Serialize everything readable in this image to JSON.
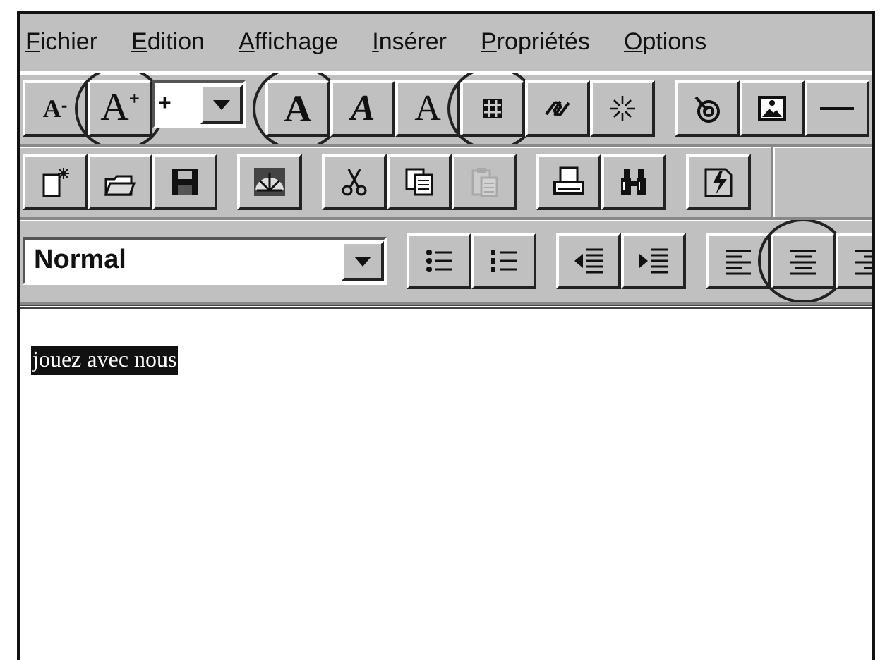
{
  "menu": [
    {
      "label": "Fichier"
    },
    {
      "label": "Edition"
    },
    {
      "label": "Affichage"
    },
    {
      "label": "Insérer"
    },
    {
      "label": "Propriétés"
    },
    {
      "label": "Options"
    }
  ],
  "toolbars": [
    {
      "groups": [
        [
          {
            "kind": "smaller",
            "label": "A$^{-}$",
            "circled": false
          },
          {
            "kind": "larger",
            "label": "A$^{+}$",
            "circled": true
          },
          {
            "kind": "size",
            "value": "+"
          }
        ],
        [
          {
            "kind": "bold",
            "label": "A",
            "circled": true
          },
          {
            "kind": "italic",
            "label": "A",
            "circled": false
          },
          {
            "kind": "fixed",
            "label": "A",
            "circled": false
          },
          {
            "kind": "table",
            "circled": true
          },
          {
            "kind": "link",
            "circled": false
          },
          {
            "kind": "sparkle",
            "circled": false
          }
        ],
        [
          {
            "kind": "target",
            "circled": false
          },
          {
            "kind": "image",
            "circled": false
          },
          {
            "kind": "rule",
            "circled": false
          }
        ]
      ]
    },
    {
      "groups": [
        [
          {
            "kind": "new",
            "circled": false,
            "disabled": false
          },
          {
            "kind": "open",
            "circled": false,
            "disabled": false
          },
          {
            "kind": "save",
            "circled": false,
            "disabled": false
          }
        ],
        [
          {
            "kind": "navigator",
            "circled": false,
            "disabled": false
          }
        ],
        [
          {
            "kind": "cut",
            "circled": false,
            "disabled": false
          },
          {
            "kind": "copy",
            "circled": false,
            "disabled": false
          },
          {
            "kind": "paste",
            "circled": false,
            "disabled": true
          }
        ],
        [
          {
            "kind": "print",
            "circled": false,
            "disabled": false
          },
          {
            "kind": "find",
            "circled": false,
            "disabled": false
          }
        ],
        [
          {
            "kind": "publish",
            "circled": false,
            "disabled": false
          }
        ]
      ]
    },
    {
      "groups": [
        [
          {
            "kind": "style",
            "value": "Normal"
          }
        ],
        [
          {
            "kind": "bullets",
            "circled": false
          },
          {
            "kind": "numbers",
            "circled": false
          }
        ],
        [
          {
            "kind": "outdent",
            "circled": false
          },
          {
            "kind": "indent",
            "circled": false
          }
        ],
        [
          {
            "kind": "align_left",
            "circled": false
          },
          {
            "kind": "align_center",
            "circled": true
          },
          {
            "kind": "align_right",
            "circled": false
          }
        ]
      ]
    }
  ],
  "document": {
    "text": "jouez avec nous",
    "selected": true
  }
}
